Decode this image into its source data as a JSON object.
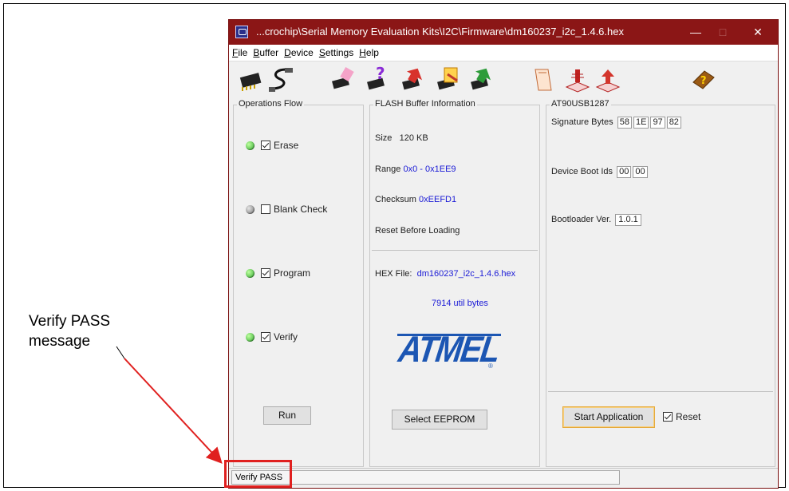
{
  "window": {
    "title": "...crochip\\Serial Memory Evaluation Kits\\I2C\\Firmware\\dm160237_i2c_1.4.6.hex",
    "minimize": "—",
    "maximize": "□",
    "close": "✕"
  },
  "menu": [
    "File",
    "Buffer",
    "Device",
    "Settings",
    "Help"
  ],
  "operations": {
    "legend": "Operations Flow",
    "items": [
      {
        "label": "Erase",
        "led": "green",
        "checked": true
      },
      {
        "label": "Blank Check",
        "led": "gray",
        "checked": false
      },
      {
        "label": "Program",
        "led": "green",
        "checked": true
      },
      {
        "label": "Verify",
        "led": "green",
        "checked": true
      }
    ],
    "run_label": "Run"
  },
  "flash": {
    "legend": "FLASH Buffer Information",
    "size_label": "Size",
    "size_value": "120 KB",
    "range_label": "Range",
    "range_value": "0x0 - 0x1EE9",
    "checksum_label": "Checksum",
    "checksum_value": "0xEEFD1",
    "reset_text": "Reset Before Loading",
    "hex_label": "HEX File:",
    "hex_value": "dm160237_i2c_1.4.6.hex",
    "util": "7914 util bytes",
    "logo": "ATMEL",
    "select_label": "Select EEPROM"
  },
  "device": {
    "legend": "AT90USB1287",
    "signature_label": "Signature Bytes",
    "signature": [
      "58",
      "1E",
      "97",
      "82"
    ],
    "boot_label": "Device Boot Ids",
    "boot_ids": [
      "00",
      "00"
    ],
    "bootloader_label": "Bootloader Ver.",
    "bootloader": "1.0.1",
    "start_label": "Start Application",
    "reset_label": "Reset",
    "reset_checked": true
  },
  "status": {
    "text": "Verify PASS"
  },
  "annotation": {
    "line1": "Verify PASS",
    "line2": "message"
  },
  "colors": {
    "titlebar": "#8b1616",
    "annotation_red": "#e0201f",
    "link_blue": "#1a1ad6",
    "atmel_blue": "#1c56b3"
  },
  "toolbar_icons": [
    "chip-icon",
    "usb-cable-icon",
    "erase-chip-icon",
    "blank-check-chip-icon",
    "program-chip-icon",
    "verify-chip-icon",
    "read-chip-icon",
    "load-hex-icon",
    "save-hex-icon",
    "export-icon",
    "help-book-icon"
  ]
}
